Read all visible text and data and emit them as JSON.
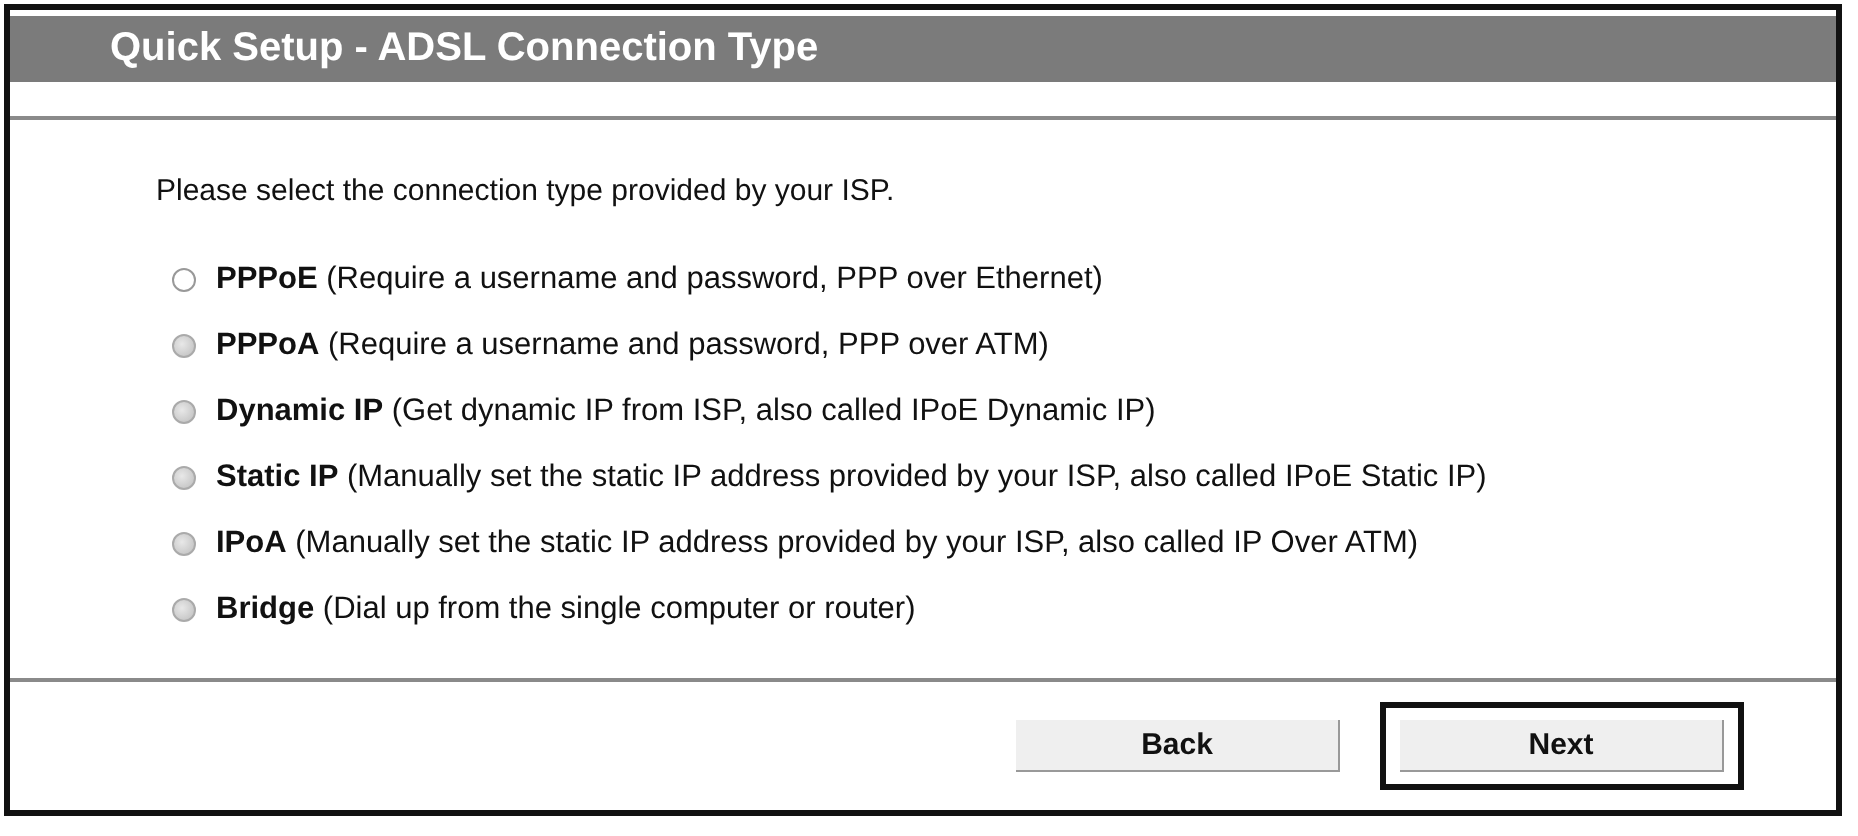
{
  "header": {
    "title": "Quick Setup - ADSL Connection Type"
  },
  "intro": "Please select the connection type provided by your ISP.",
  "options": [
    {
      "name": "PPPoE",
      "description": "(Require a username and password, PPP over Ethernet)",
      "selected": false,
      "disabled": false
    },
    {
      "name": "PPPoA",
      "description": "(Require a username and password, PPP over ATM)",
      "selected": false,
      "disabled": true
    },
    {
      "name": "Dynamic IP",
      "description": "(Get dynamic IP from ISP, also called IPoE Dynamic IP)",
      "selected": false,
      "disabled": true
    },
    {
      "name": "Static IP",
      "description": "(Manually set the static IP address provided by your ISP, also called IPoE Static IP)",
      "selected": false,
      "disabled": true
    },
    {
      "name": "IPoA",
      "description": "(Manually set the static IP address provided by your ISP, also called IP Over ATM)",
      "selected": false,
      "disabled": true
    },
    {
      "name": "Bridge",
      "description": "(Dial up from the single computer or router)",
      "selected": false,
      "disabled": true
    }
  ],
  "buttons": [
    {
      "label": "Back",
      "highlighted": false
    },
    {
      "label": "Next",
      "highlighted": true
    }
  ]
}
